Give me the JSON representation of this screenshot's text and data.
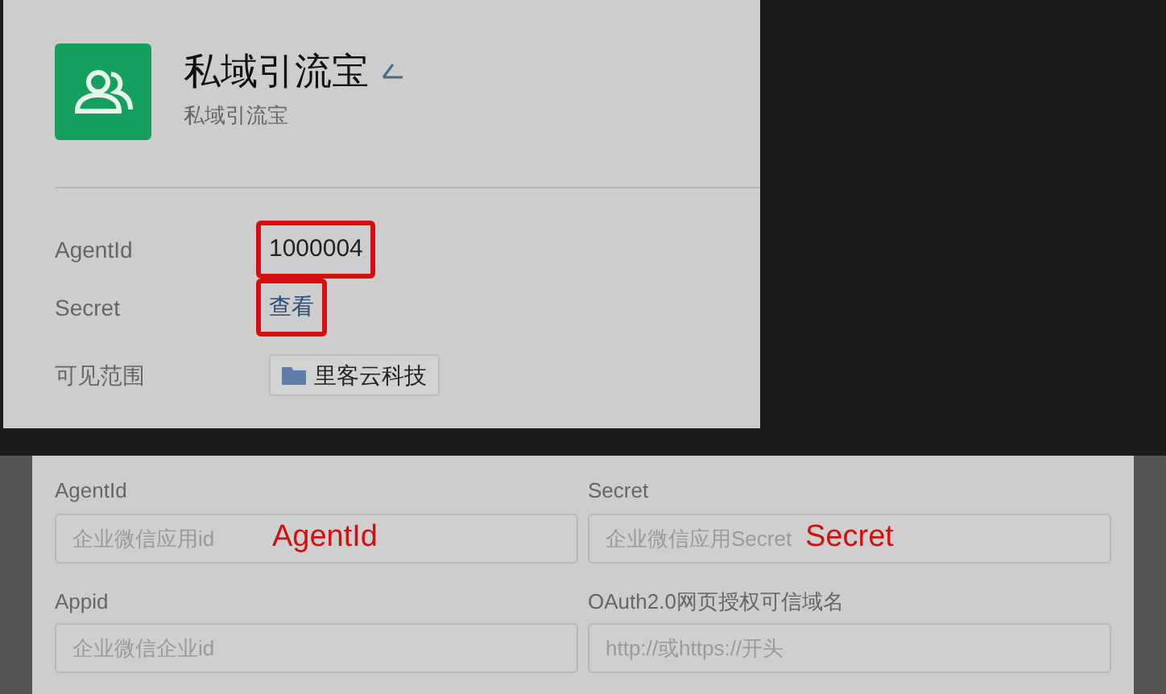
{
  "app": {
    "name": "私域引流宝",
    "subtitle": "私域引流宝"
  },
  "details": [
    {
      "label": "AgentId",
      "value": "1000004",
      "kind": "text",
      "highlighted": true
    },
    {
      "label": "Secret",
      "value": "查看",
      "kind": "link",
      "highlighted": true
    },
    {
      "label": "可见范围",
      "value": "里客云科技",
      "kind": "tag",
      "highlighted": false
    }
  ],
  "form": [
    {
      "label": "AgentId",
      "placeholder": "企业微信应用id",
      "annotation": "AgentId"
    },
    {
      "label": "Secret",
      "placeholder": "企业微信应用Secret",
      "annotation": "Secret"
    },
    {
      "label": "Appid",
      "placeholder": "企业微信企业id"
    },
    {
      "label": "OAuth2.0网页授权可信域名",
      "placeholder": "http://或https://开头"
    }
  ]
}
